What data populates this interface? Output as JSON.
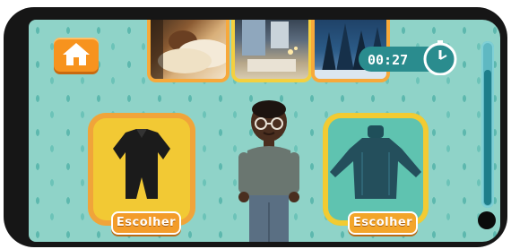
{
  "timer": {
    "display": "00:27"
  },
  "progress": {
    "fraction": 0.84
  },
  "scene_thumbnails": [
    {
      "name": "bedroom-sleeping-thumb"
    },
    {
      "name": "room-lights-thumb"
    },
    {
      "name": "snowy-forest-thumb"
    }
  ],
  "choices": [
    {
      "item": "black-outfit",
      "button_label": "Escolher"
    },
    {
      "item": "teal-sweater",
      "button_label": "Escolher"
    }
  ],
  "colors": {
    "background": "#8fd3c8",
    "button_orange": "#f39c2a",
    "card_yellow": "#f2c934",
    "card_teal": "#5fc3b0",
    "timer_teal": "#2a8c8e"
  },
  "icons": {
    "home": "home-icon",
    "stopwatch": "stopwatch-icon"
  }
}
